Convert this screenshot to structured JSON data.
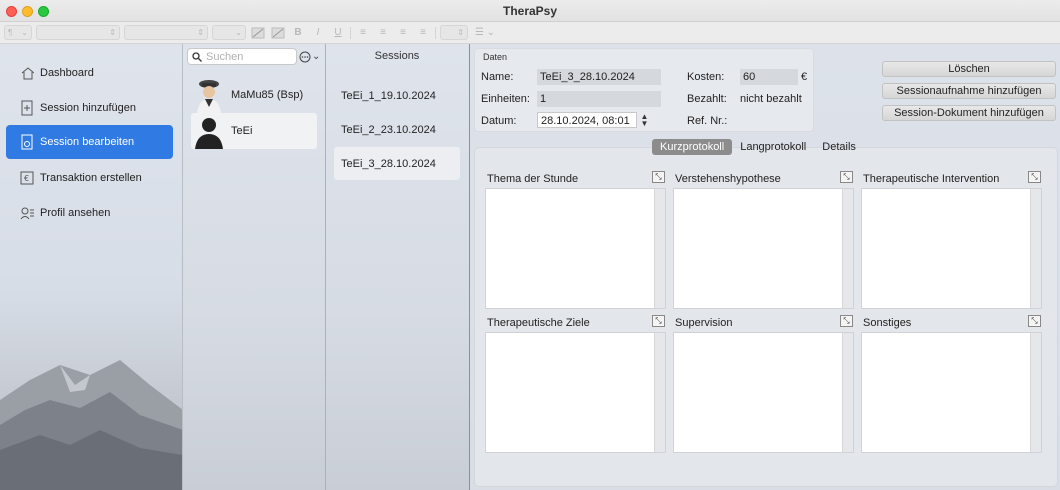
{
  "window": {
    "title": "TheraPsy"
  },
  "toolbar": {
    "para_label": "¶",
    "bold": "B",
    "italic": "I",
    "underline": "U"
  },
  "sidebar": {
    "items": [
      {
        "label": "Dashboard",
        "icon": "house-icon"
      },
      {
        "label": "Session hinzufügen",
        "icon": "add-document-icon"
      },
      {
        "label": "Session bearbeiten",
        "icon": "edit-document-icon",
        "active": true
      },
      {
        "label": "Transaktion erstellen",
        "icon": "euro-icon"
      },
      {
        "label": "Profil ansehen",
        "icon": "profile-icon"
      }
    ]
  },
  "patients": {
    "search_placeholder": "Suchen",
    "list": [
      {
        "name": "MaMu85 (Bsp)",
        "avatar": "person-avatar"
      },
      {
        "name": "TeEi",
        "avatar": "silhouette-avatar",
        "selected": true
      }
    ]
  },
  "sessions": {
    "header": "Sessions",
    "list": [
      {
        "name": "TeEi_1_19.10.2024"
      },
      {
        "name": "TeEi_2_23.10.2024"
      },
      {
        "name": "TeEi_3_28.10.2024",
        "selected": true
      }
    ]
  },
  "daten": {
    "title": "Daten",
    "name_label": "Name:",
    "name_value": "TeEi_3_28.10.2024",
    "einheiten_label": "Einheiten:",
    "einheiten_value": "1",
    "datum_label": "Datum:",
    "datum_value": "28.10.2024, 08:01",
    "kosten_label": "Kosten:",
    "kosten_value": "60",
    "currency": "€",
    "bezahlt_label": "Bezahlt:",
    "bezahlt_value": "nicht bezahlt",
    "refnr_label": "Ref. Nr.:"
  },
  "actions": {
    "delete": "Löschen",
    "add_recording": "Sessionaufnahme hinzufügen",
    "add_document": "Session-Dokument hinzufügen"
  },
  "tabs": [
    {
      "label": "Kurzprotokoll",
      "active": true
    },
    {
      "label": "Langprotokoll"
    },
    {
      "label": "Details"
    }
  ],
  "cards": [
    {
      "title": "Thema der Stunde"
    },
    {
      "title": "Verstehenshypothese"
    },
    {
      "title": "Therapeutische Intervention"
    },
    {
      "title": "Therapeutische Ziele"
    },
    {
      "title": "Supervision"
    },
    {
      "title": "Sonstiges"
    }
  ],
  "colors": {
    "accent": "#2f7be3",
    "active_tab": "#8c8c8c"
  }
}
